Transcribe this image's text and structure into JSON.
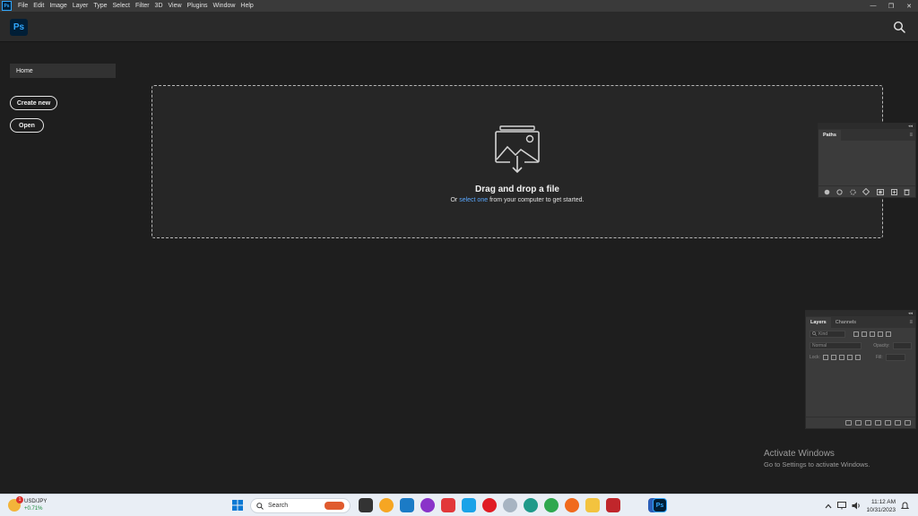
{
  "menubar": {
    "app_badge": "Ps",
    "items": [
      "File",
      "Edit",
      "Image",
      "Layer",
      "Type",
      "Select",
      "Filter",
      "3D",
      "View",
      "Plugins",
      "Window",
      "Help"
    ],
    "window_controls": [
      "—",
      "❐",
      "✕"
    ]
  },
  "app": {
    "logo": "Ps",
    "search_icon": "search-icon"
  },
  "nav": {
    "home_label": "Home",
    "create_new_label": "Create new",
    "open_label": "Open"
  },
  "dropzone": {
    "title": "Drag and drop a file",
    "sub_prefix": "Or ",
    "sub_link": "select one",
    "sub_suffix": " from your computer to get started."
  },
  "paths_panel": {
    "collapse": "◂◂",
    "tab": "Paths",
    "menu_icon": "≡"
  },
  "layers_panel": {
    "collapse": "◂◂",
    "tabs": [
      "Layers",
      "Channels"
    ],
    "menu_icon": "≡",
    "filter_placeholder": "Kind",
    "blend_mode": "Normal",
    "opacity_label": "Opacity:",
    "lock_label": "Lock:",
    "fill_label": "Fill:"
  },
  "watermark": {
    "title": "Activate Windows",
    "subtitle": "Go to Settings to activate Windows."
  },
  "taskbar": {
    "ticker_symbol": "USD/JPY",
    "ticker_change": "+0.71%",
    "ticker_badge": "1",
    "search_label": "Search",
    "time": "11:12 AM",
    "date": "10/31/2023",
    "accent_colors": {
      "ps": "#31a8ff",
      "link": "#5aa8ff",
      "ticker_up": "#188a3a"
    }
  }
}
